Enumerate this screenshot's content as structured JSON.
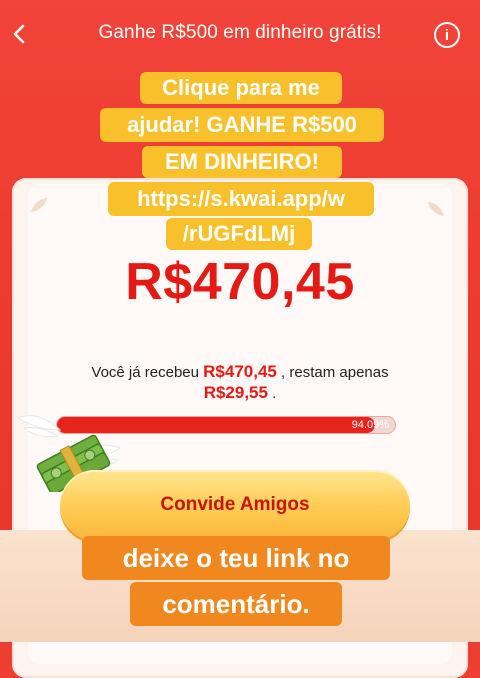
{
  "header": {
    "title": "Ganhe R$500 em dinheiro grátis!",
    "back_icon": "chevron-left-icon",
    "info_icon": "info-icon",
    "info_glyph": "i"
  },
  "overlay_top": {
    "lines": [
      "Clique para me",
      "ajudar! GANHE R$500",
      "EM DINHEIRO!",
      "https://s.kwai.app/w",
      "/rUGFdLMj"
    ]
  },
  "main": {
    "amount": "R$470,45",
    "received_prefix": "Você já recebeu",
    "received_amount": "R$470,45",
    "received_middle": ", restam apenas",
    "remaining_amount": "R$29,55",
    "received_suffix": ".",
    "progress_label": "94.09%",
    "progress_value": 94.09
  },
  "invite_button": {
    "label": "Convide Amigos"
  },
  "overlay_bottom": {
    "lines": [
      "deixe o teu link no",
      "comentário."
    ]
  },
  "colors": {
    "background": "#ee3d31",
    "amount_red": "#e51a14",
    "button_gold": "#ffd05a",
    "overlay_yellow": "#f8c12b",
    "overlay_orange": "#f0871f"
  }
}
